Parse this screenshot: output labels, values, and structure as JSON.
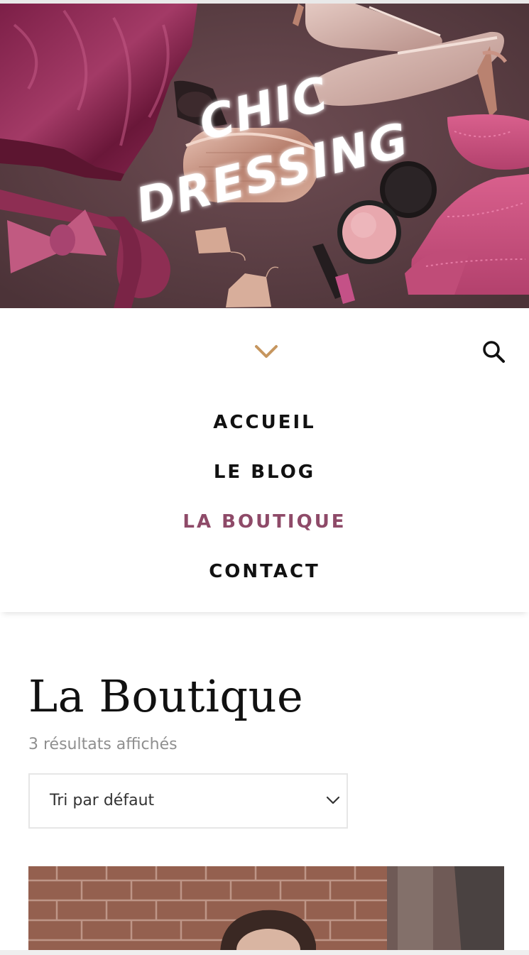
{
  "site": {
    "logo_line1": "CHIC",
    "logo_line2": "DRESSING"
  },
  "header": {
    "menu_toggle_icon": "chevron-down-icon",
    "search_icon": "search-icon",
    "accent_color": "#c6965f"
  },
  "nav": {
    "items": [
      {
        "label": "ACCUEIL",
        "active": false
      },
      {
        "label": "LE BLOG",
        "active": false
      },
      {
        "label": "LA BOUTIQUE",
        "active": true
      },
      {
        "label": "CONTACT",
        "active": false
      }
    ],
    "active_color": "#8e4a68"
  },
  "shop": {
    "title": "La Boutique",
    "result_count": "3 résultats affichés",
    "sort": {
      "selected": "Tri par défaut",
      "icon": "chevron-down-icon"
    }
  }
}
